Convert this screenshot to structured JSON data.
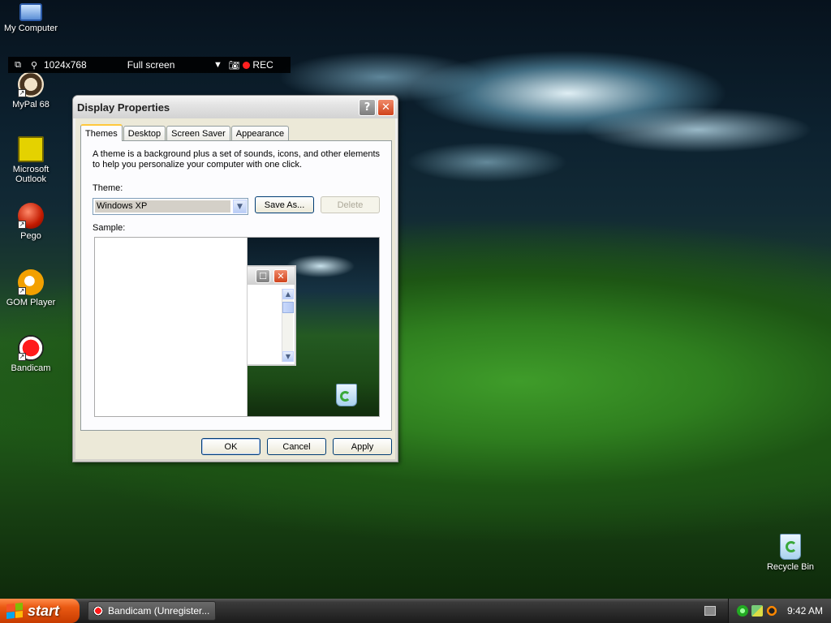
{
  "desktop": {
    "icons": [
      {
        "label": "My Computer",
        "icon": "computer-icon"
      },
      {
        "label": "MyPal 68",
        "icon": "mypal-icon"
      },
      {
        "label": "Microsoft Outlook",
        "icon": "outlook-icon"
      },
      {
        "label": "Pego",
        "icon": "pego-icon"
      },
      {
        "label": "GOM Player",
        "icon": "gom-player-icon"
      },
      {
        "label": "Bandicam",
        "icon": "bandicam-icon"
      },
      {
        "label": "Recycle Bin",
        "icon": "recycle-bin-icon"
      }
    ]
  },
  "bandicam_bar": {
    "resolution": "1024x768",
    "mode": "Full screen",
    "rec_label": "REC",
    "rec_color": "#ff2020"
  },
  "dialog": {
    "title": "Display Properties",
    "help_glyph": "?",
    "close_glyph": "✕",
    "tabs": [
      {
        "label": "Themes",
        "active": true
      },
      {
        "label": "Desktop",
        "active": false
      },
      {
        "label": "Screen Saver",
        "active": false
      },
      {
        "label": "Appearance",
        "active": false
      }
    ],
    "description": "A theme is a background plus a set of sounds, icons, and other elements to help you personalize your computer with one click.",
    "theme_label": "Theme:",
    "theme_value": "Windows XP",
    "save_as_label": "Save As...",
    "delete_label": "Delete",
    "sample_label": "Sample:",
    "buttons": {
      "ok": "OK",
      "cancel": "Cancel",
      "apply": "Apply"
    }
  },
  "taskbar": {
    "start_label": "start",
    "start_color": "#e2560f",
    "task_button": "Bandicam (Unregister...",
    "clock": "9:42 AM"
  }
}
